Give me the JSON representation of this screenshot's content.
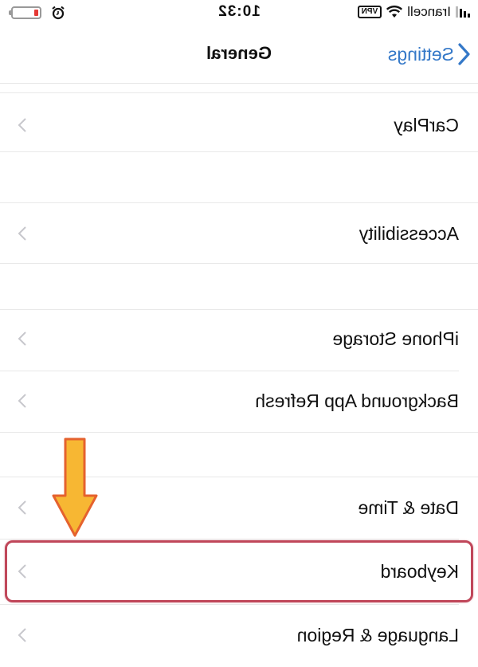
{
  "status_bar": {
    "carrier": "Irancell",
    "vpn": "VPN",
    "time": "10:32",
    "battery_color": "#e53935",
    "icons": [
      "signal-icon",
      "wifi-icon",
      "alarm-icon",
      "battery-icon"
    ]
  },
  "nav": {
    "back_label": "Settings",
    "title": "General",
    "accent_color": "#3478c8"
  },
  "rows": [
    {
      "label": "CarPlay"
    },
    {
      "label": "Accessibility"
    },
    {
      "label": "iPhone Storage"
    },
    {
      "label": "Background App Refresh"
    },
    {
      "label": "Date & Time"
    },
    {
      "label": "Keyboard",
      "highlighted": true
    },
    {
      "label": "Language & Region"
    }
  ],
  "annotation": {
    "arrow_color": "#f7b733",
    "highlight_color": "#c0475a"
  }
}
